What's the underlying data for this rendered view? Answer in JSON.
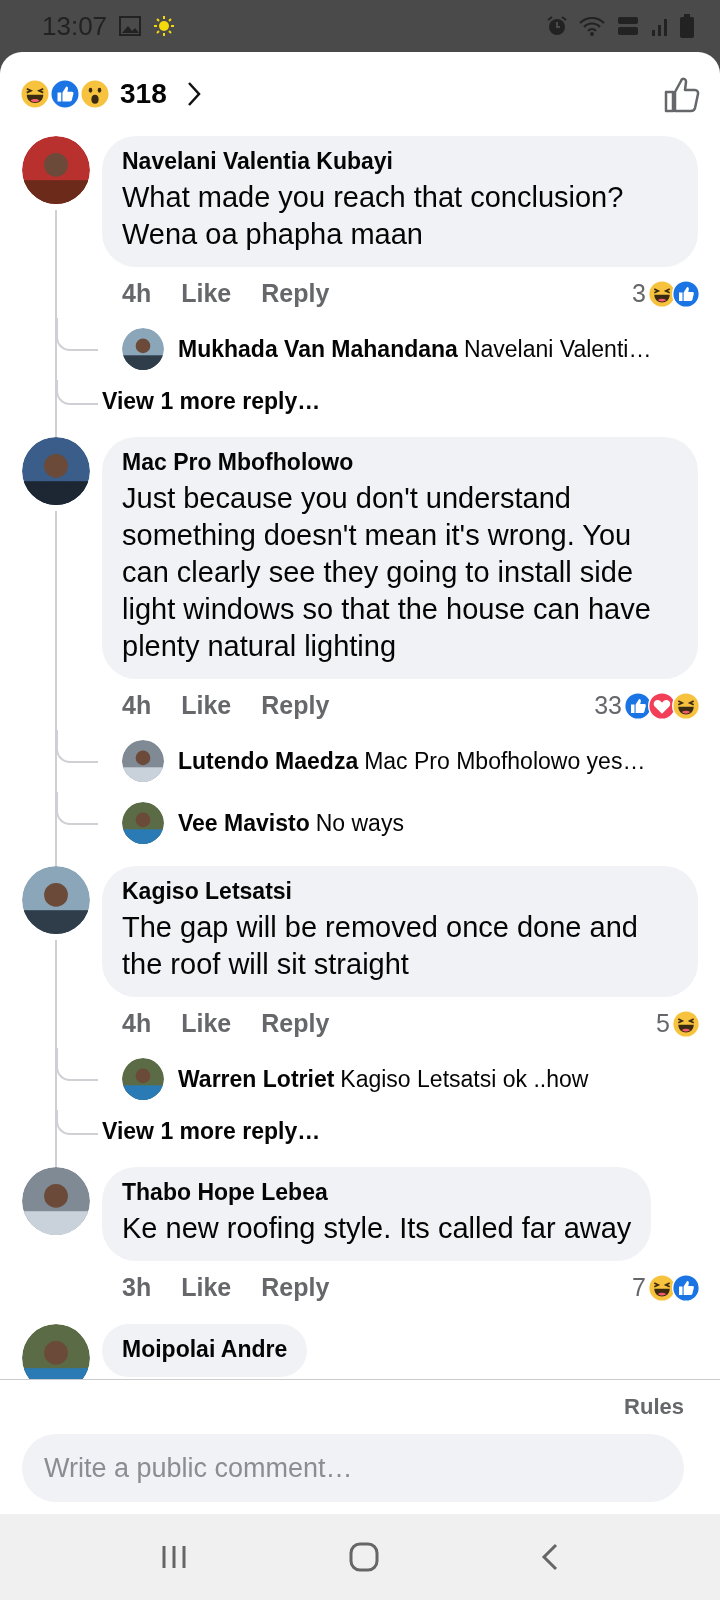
{
  "status_bar": {
    "time": "13:07"
  },
  "header": {
    "reactions": [
      {
        "kind": "haha"
      },
      {
        "kind": "like"
      },
      {
        "kind": "wow"
      }
    ],
    "count": "318"
  },
  "comments": [
    {
      "name": "Navelani Valentia Kubayi",
      "text": "What made you reach that conclusion? Wena oa phapha maan",
      "time": "4h",
      "like": "Like",
      "reply": "Reply",
      "reaction_count": "3",
      "reactions": [
        {
          "kind": "haha"
        },
        {
          "kind": "like"
        }
      ],
      "replies": [
        {
          "name": "Mukhada Van Mahandana",
          "text": "Navelani Valenti…"
        }
      ],
      "more_replies": "View 1 more reply…"
    },
    {
      "name": "Mac Pro Mbofholowo",
      "text": "Just because you don't understand something doesn't mean it's wrong. You can clearly see they going to install side light windows so that the house can have plenty natural lighting",
      "time": "4h",
      "like": "Like",
      "reply": "Reply",
      "reaction_count": "33",
      "reactions": [
        {
          "kind": "like"
        },
        {
          "kind": "love"
        },
        {
          "kind": "haha"
        }
      ],
      "replies": [
        {
          "name": "Lutendo Maedza",
          "text": "Mac Pro Mbofholowo yes…"
        },
        {
          "name": "Vee Mavisto",
          "text": "No ways"
        }
      ]
    },
    {
      "name": "Kagiso Letsatsi",
      "text": "The gap will be removed once done and the roof will sit straight",
      "time": "4h",
      "like": "Like",
      "reply": "Reply",
      "reaction_count": "5",
      "reactions": [
        {
          "kind": "haha"
        }
      ],
      "replies": [
        {
          "name": "Warren Lotriet",
          "text": "Kagiso Letsatsi ok ..how"
        }
      ],
      "more_replies": "View 1 more reply…"
    },
    {
      "name": "Thabo Hope Lebea",
      "text": "Ke new roofing style. Its called far away",
      "time": "3h",
      "like": "Like",
      "reply": "Reply",
      "reaction_count": "7",
      "reactions": [
        {
          "kind": "haha"
        },
        {
          "kind": "like"
        }
      ]
    },
    {
      "name": "Moipolai Andre"
    }
  ],
  "footer": {
    "rules": "Rules",
    "placeholder": "Write a public comment…"
  }
}
